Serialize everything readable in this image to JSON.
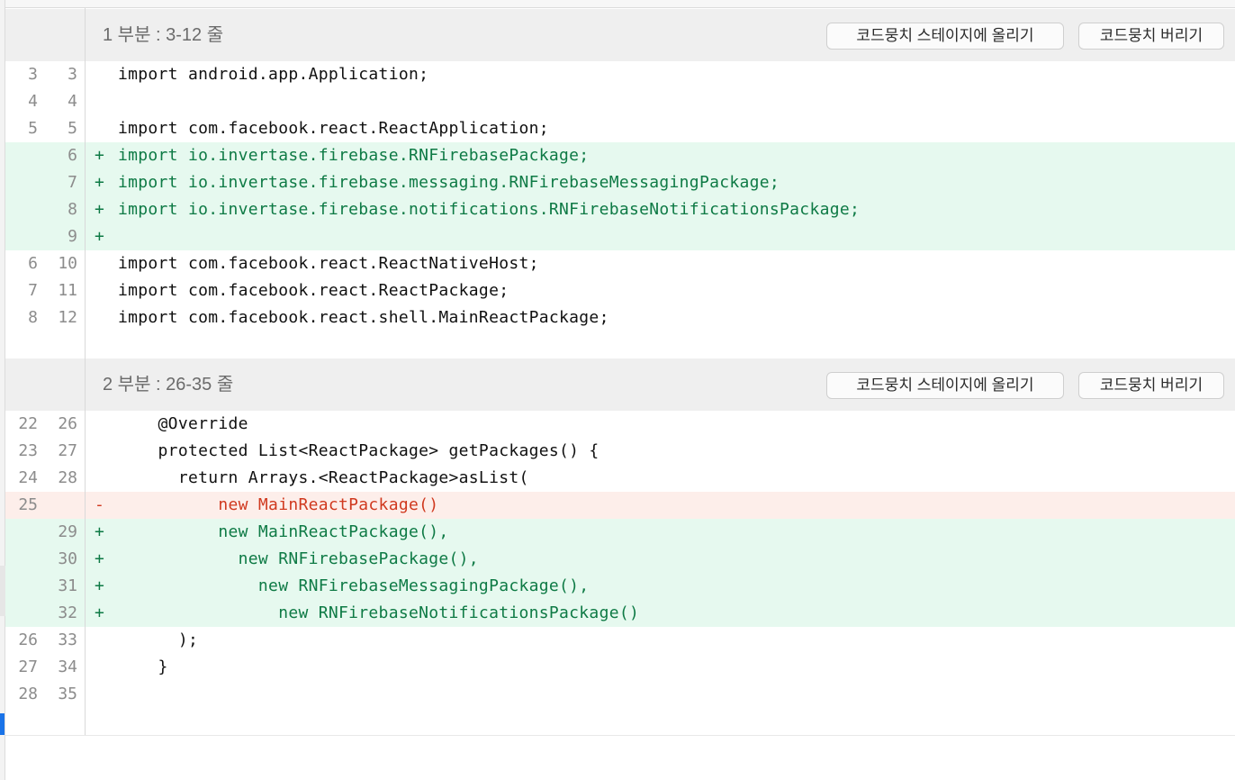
{
  "hunks": [
    {
      "title": "1 부분 : 3-12 줄",
      "stage_label": "코드뭉치 스테이지에 올리기",
      "discard_label": "코드뭉치 버리기",
      "lines": [
        {
          "old": "3",
          "new": "3",
          "type": "ctx",
          "sign": "",
          "code": "import android.app.Application;"
        },
        {
          "old": "4",
          "new": "4",
          "type": "ctx",
          "sign": "",
          "code": ""
        },
        {
          "old": "5",
          "new": "5",
          "type": "ctx",
          "sign": "",
          "code": "import com.facebook.react.ReactApplication;"
        },
        {
          "old": "",
          "new": "6",
          "type": "add",
          "sign": "+",
          "code": "import io.invertase.firebase.RNFirebasePackage;"
        },
        {
          "old": "",
          "new": "7",
          "type": "add",
          "sign": "+",
          "code": "import io.invertase.firebase.messaging.RNFirebaseMessagingPackage;"
        },
        {
          "old": "",
          "new": "8",
          "type": "add",
          "sign": "+",
          "code": "import io.invertase.firebase.notifications.RNFirebaseNotificationsPackage;"
        },
        {
          "old": "",
          "new": "9",
          "type": "add",
          "sign": "+",
          "code": ""
        },
        {
          "old": "6",
          "new": "10",
          "type": "ctx",
          "sign": "",
          "code": "import com.facebook.react.ReactNativeHost;"
        },
        {
          "old": "7",
          "new": "11",
          "type": "ctx",
          "sign": "",
          "code": "import com.facebook.react.ReactPackage;"
        },
        {
          "old": "8",
          "new": "12",
          "type": "ctx",
          "sign": "",
          "code": "import com.facebook.react.shell.MainReactPackage;"
        }
      ]
    },
    {
      "title": "2 부분 : 26-35 줄",
      "stage_label": "코드뭉치 스테이지에 올리기",
      "discard_label": "코드뭉치 버리기",
      "lines": [
        {
          "old": "22",
          "new": "26",
          "type": "ctx",
          "sign": "",
          "code": "    @Override"
        },
        {
          "old": "23",
          "new": "27",
          "type": "ctx",
          "sign": "",
          "code": "    protected List<ReactPackage> getPackages() {"
        },
        {
          "old": "24",
          "new": "28",
          "type": "ctx",
          "sign": "",
          "code": "      return Arrays.<ReactPackage>asList("
        },
        {
          "old": "25",
          "new": "",
          "type": "del",
          "sign": "-",
          "code": "          new MainReactPackage()"
        },
        {
          "old": "",
          "new": "29",
          "type": "add",
          "sign": "+",
          "code": "          new MainReactPackage(),"
        },
        {
          "old": "",
          "new": "30",
          "type": "add",
          "sign": "+",
          "code": "            new RNFirebasePackage(),"
        },
        {
          "old": "",
          "new": "31",
          "type": "add",
          "sign": "+",
          "code": "              new RNFirebaseMessagingPackage(),"
        },
        {
          "old": "",
          "new": "32",
          "type": "add",
          "sign": "+",
          "code": "                new RNFirebaseNotificationsPackage()"
        },
        {
          "old": "26",
          "new": "33",
          "type": "ctx",
          "sign": "",
          "code": "      );"
        },
        {
          "old": "27",
          "new": "34",
          "type": "ctx",
          "sign": "",
          "code": "    }"
        },
        {
          "old": "28",
          "new": "35",
          "type": "ctx",
          "sign": "",
          "code": ""
        }
      ]
    }
  ],
  "colors": {
    "added_bg": "#e6f9ef",
    "added_text": "#0e7a45",
    "removed_bg": "#fdeeea",
    "removed_text": "#d0391f",
    "hunk_header_bg": "#efefef"
  }
}
